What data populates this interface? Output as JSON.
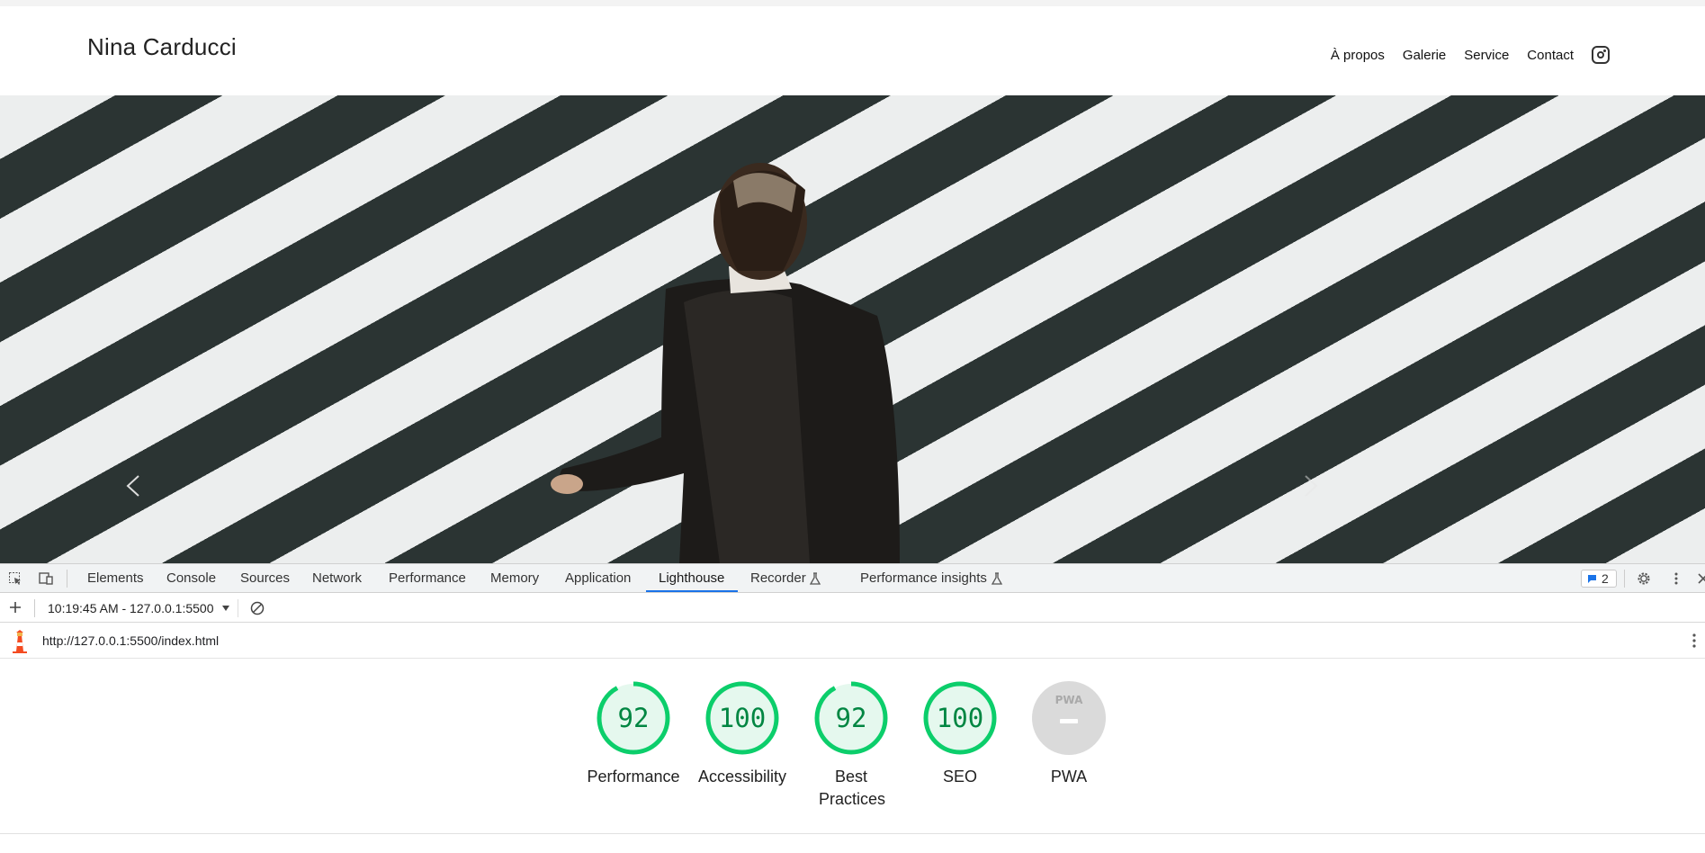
{
  "site": {
    "title": "Nina Carducci",
    "nav": [
      "À propos",
      "Galerie",
      "Service",
      "Contact"
    ]
  },
  "devtools": {
    "tabs": [
      "Elements",
      "Console",
      "Sources",
      "Network",
      "Performance",
      "Memory",
      "Application",
      "Lighthouse",
      "Recorder",
      "Performance insights"
    ],
    "active_tab": "Lighthouse",
    "issues_count": "2",
    "report_selector": "10:19:45 AM - 127.0.0.1:5500",
    "report_url": "http://127.0.0.1:5500/index.html"
  },
  "scores": [
    {
      "value": "92",
      "label": "Performance",
      "fraction": 0.92
    },
    {
      "value": "100",
      "label": "Accessibility",
      "fraction": 1.0
    },
    {
      "value": "92",
      "label": "Best Practices",
      "fraction": 0.92
    },
    {
      "value": "100",
      "label": "SEO",
      "fraction": 1.0
    },
    {
      "value": "",
      "label": "PWA",
      "badge": "PWA"
    }
  ],
  "colors": {
    "pass": "#0cce6b",
    "pass_text": "#018642",
    "pass_bg": "#e5f8ee",
    "tab_underline": "#1a73e8"
  }
}
